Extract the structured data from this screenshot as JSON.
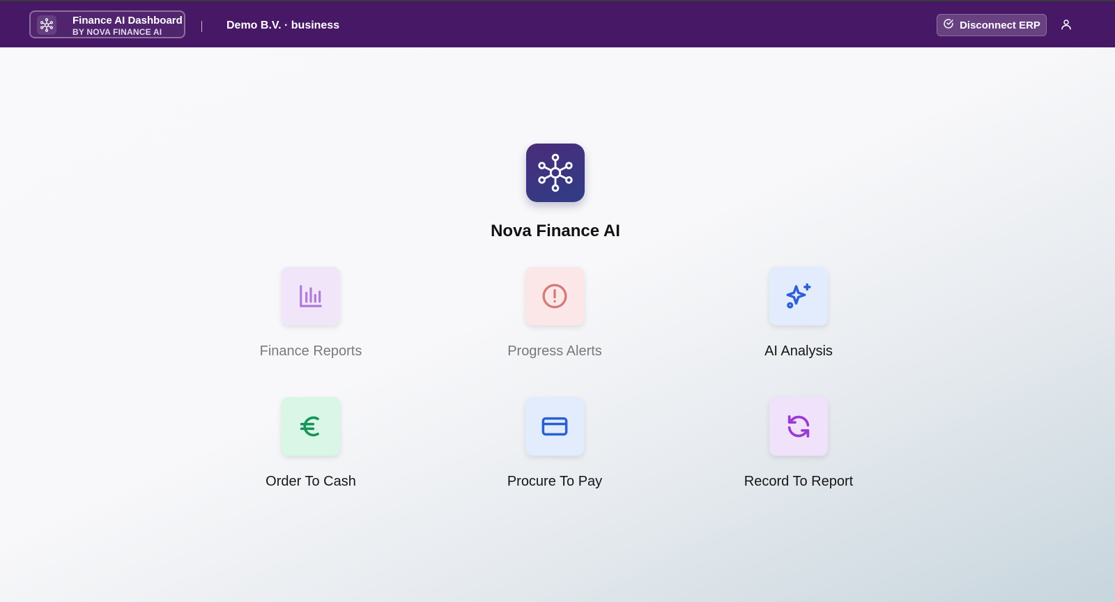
{
  "header": {
    "brand_title": "Finance AI Dashboard",
    "brand_subtitle": "BY NOVA FINANCE AI",
    "brand_icon": "network-icon",
    "org_label": "Demo B.V. · business",
    "disconnect_label": "Disconnect ERP",
    "disconnect_icon": "check-circle-icon",
    "user_icon": "user-icon",
    "background_color": "#461865"
  },
  "hero": {
    "title": "Nova Finance AI",
    "icon": "network-icon"
  },
  "tiles": [
    {
      "label": "Finance Reports",
      "icon": "bar-chart-icon",
      "state": "disabled",
      "bg": "#f1e5fa",
      "fg": "#b07ad8"
    },
    {
      "label": "Progress Alerts",
      "icon": "alert-circle-icon",
      "state": "disabled",
      "bg": "#fbe7e7",
      "fg": "#d47a7a"
    },
    {
      "label": "AI Analysis",
      "icon": "sparkles-icon",
      "state": "enabled",
      "bg": "#e3ecfd",
      "fg": "#2f5fd8"
    },
    {
      "label": "Order To Cash",
      "icon": "euro-icon",
      "state": "enabled",
      "bg": "#d9f6e6",
      "fg": "#18935a"
    },
    {
      "label": "Procure To Pay",
      "icon": "credit-card-icon",
      "state": "enabled",
      "bg": "#e2ecfd",
      "fg": "#2760d2"
    },
    {
      "label": "Record To Report",
      "icon": "refresh-icon",
      "state": "enabled",
      "bg": "#f0e2fb",
      "fg": "#9a3ad6"
    }
  ]
}
